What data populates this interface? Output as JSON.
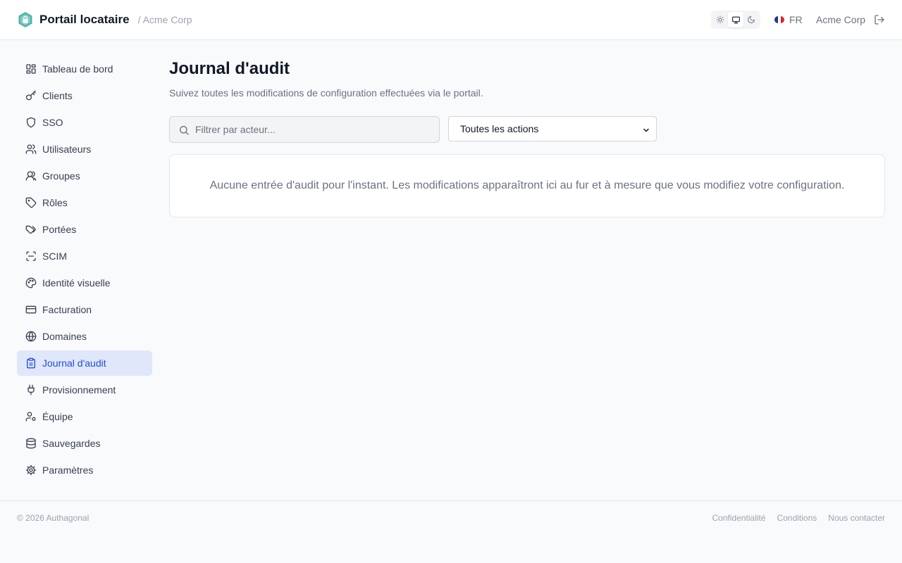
{
  "header": {
    "logo_icon": "hexagon-lock-logo",
    "title": "Portail locataire",
    "org_crumb": "/ Acme Corp",
    "theme_options": [
      "sun-icon",
      "monitor-icon",
      "moon-icon"
    ],
    "theme_selected": "monitor-icon",
    "language": "FR",
    "org_name": "Acme Corp",
    "logout_icon": "logout-icon",
    "accent_color": "#4fb3a9"
  },
  "sidebar": {
    "items": [
      {
        "label": "Tableau de bord",
        "icon": "dashboard-icon"
      },
      {
        "label": "Clients",
        "icon": "key-icon"
      },
      {
        "label": "SSO",
        "icon": "shield-icon"
      },
      {
        "label": "Utilisateurs",
        "icon": "users-icon"
      },
      {
        "label": "Groupes",
        "icon": "group-icon"
      },
      {
        "label": "Rôles",
        "icon": "tag-icon"
      },
      {
        "label": "Portées",
        "icon": "tags-icon"
      },
      {
        "label": "SCIM",
        "icon": "scan-icon"
      },
      {
        "label": "Identité visuelle",
        "icon": "palette-icon"
      },
      {
        "label": "Facturation",
        "icon": "credit-card-icon"
      },
      {
        "label": "Domaines",
        "icon": "globe-icon"
      },
      {
        "label": "Journal d'audit",
        "icon": "clipboard-icon",
        "active": true
      },
      {
        "label": "Provisionnement",
        "icon": "plug-icon"
      },
      {
        "label": "Équipe",
        "icon": "user-cog-icon"
      },
      {
        "label": "Sauvegardes",
        "icon": "database-icon"
      },
      {
        "label": "Paramètres",
        "icon": "settings-icon"
      }
    ],
    "active_color": "#1d4ed8",
    "active_bg": "#e0e7fb"
  },
  "main": {
    "title": "Journal d'audit",
    "subtitle": "Suivez toutes les modifications de configuration effectuées via le portail.",
    "search": {
      "placeholder": "Filtrer par acteur...",
      "value": ""
    },
    "action_filter": {
      "selected": "Toutes les actions"
    },
    "empty_message": "Aucune entrée d'audit pour l'instant. Les modifications apparaîtront ici au fur et à mesure que vous modifiez votre configuration."
  },
  "footer": {
    "copyright": "© 2026 Authagonal",
    "links": [
      "Confidentialité",
      "Conditions",
      "Nous contacter"
    ]
  }
}
